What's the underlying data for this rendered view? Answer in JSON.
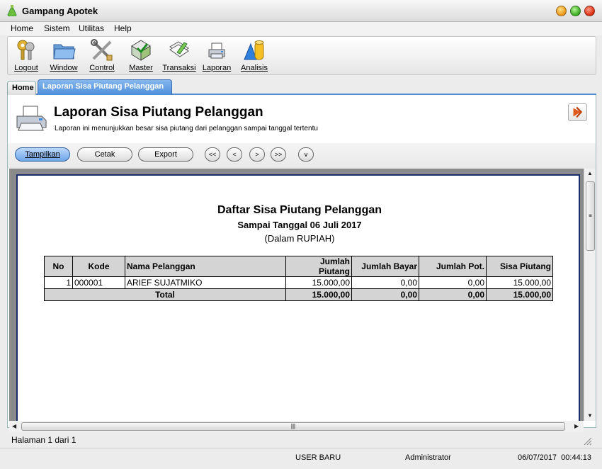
{
  "window": {
    "title": "Gampang Apotek"
  },
  "menu": [
    "Home",
    "Sistem",
    "Utilitas",
    "Help"
  ],
  "toolbar": [
    {
      "label": "Logout",
      "icon": "keys-icon"
    },
    {
      "label": "Window",
      "icon": "folder-icon"
    },
    {
      "label": "Control",
      "icon": "tools-icon"
    },
    {
      "label": "Master",
      "icon": "master-icon"
    },
    {
      "label": "Transaksi",
      "icon": "transaction-icon"
    },
    {
      "label": "Laporan",
      "icon": "printer-icon"
    },
    {
      "label": "Analisis",
      "icon": "analysis-icon"
    }
  ],
  "tabs": {
    "home": "Home",
    "active": "Laporan Sisa Piutang Pelanggan"
  },
  "header": {
    "title": "Laporan Sisa Piutang Pelanggan",
    "subtitle": "Laporan ini menunjukkan besar sisa piutang dari pelanggan sampai tanggal tertentu"
  },
  "actions": {
    "show": "Tampilkan",
    "print": "Cetak",
    "export": "Export"
  },
  "nav": {
    "first": "<<",
    "prev": "<",
    "next": ">",
    "last": ">>",
    "down": "v"
  },
  "report": {
    "title": "Daftar Sisa Piutang Pelanggan",
    "subtitle": "Sampai Tanggal 06 Juli 2017",
    "unit": "(Dalam RUPIAH)",
    "columns": [
      "No",
      "Kode",
      "Nama Pelanggan",
      "Jumlah Piutang",
      "Jumlah Bayar",
      "Jumlah Pot.",
      "Sisa Piutang"
    ],
    "rows": [
      {
        "no": "1",
        "kode": "000001",
        "nama": "ARIEF SUJATMIKO",
        "piutang": "15.000,00",
        "bayar": "0,00",
        "pot": "0,00",
        "sisa": "15.000,00"
      }
    ],
    "total": {
      "label": "Total",
      "piutang": "15.000,00",
      "bayar": "0,00",
      "pot": "0,00",
      "sisa": "15.000,00"
    }
  },
  "page_status": "Halaman 1 dari 1",
  "status": {
    "user": "USER BARU",
    "role": "Administrator",
    "datetime": "06/07/2017  00:44:13"
  }
}
